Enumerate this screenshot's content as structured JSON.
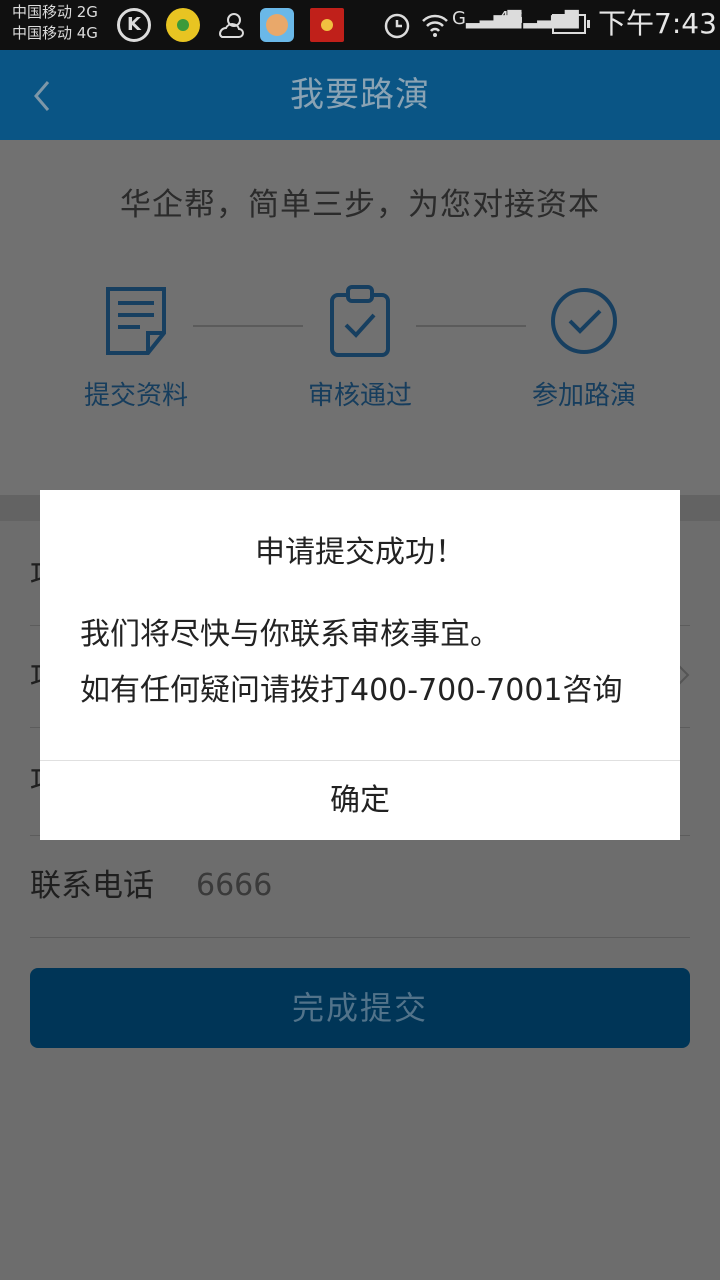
{
  "status_bar": {
    "carrier_1": "中国移动 2G",
    "carrier_2": "中国移动 4G",
    "signal_1": "G",
    "signal_2": "4G",
    "battery": "70",
    "time": "下午7:43"
  },
  "nav": {
    "title": "我要路演"
  },
  "hero": {
    "slogan": "华企帮，简单三步，为您对接资本",
    "steps": [
      {
        "label": "提交资料",
        "icon": "document-icon"
      },
      {
        "label": "审核通过",
        "icon": "clipboard-check-icon"
      },
      {
        "label": "参加路演",
        "icon": "check-circle-icon"
      }
    ]
  },
  "form": {
    "rows": [
      {
        "label": "项",
        "value": ""
      },
      {
        "label": "项",
        "value": ""
      },
      {
        "label": "项",
        "value": ""
      },
      {
        "label": "联系电话",
        "value": "6666"
      }
    ],
    "submit_label": "完成提交"
  },
  "dialog": {
    "title": "申请提交成功！",
    "message_line_1": "我们将尽快与你联系审核事宜。",
    "message_line_2": "如有任何疑问请拨打400-700-7001咨询",
    "confirm_label": "确定"
  },
  "colors": {
    "nav_bg": "#0a5585",
    "accent": "#0a5585",
    "overlay": "#6d6d6d",
    "dialog_bg": "#ffffff"
  }
}
